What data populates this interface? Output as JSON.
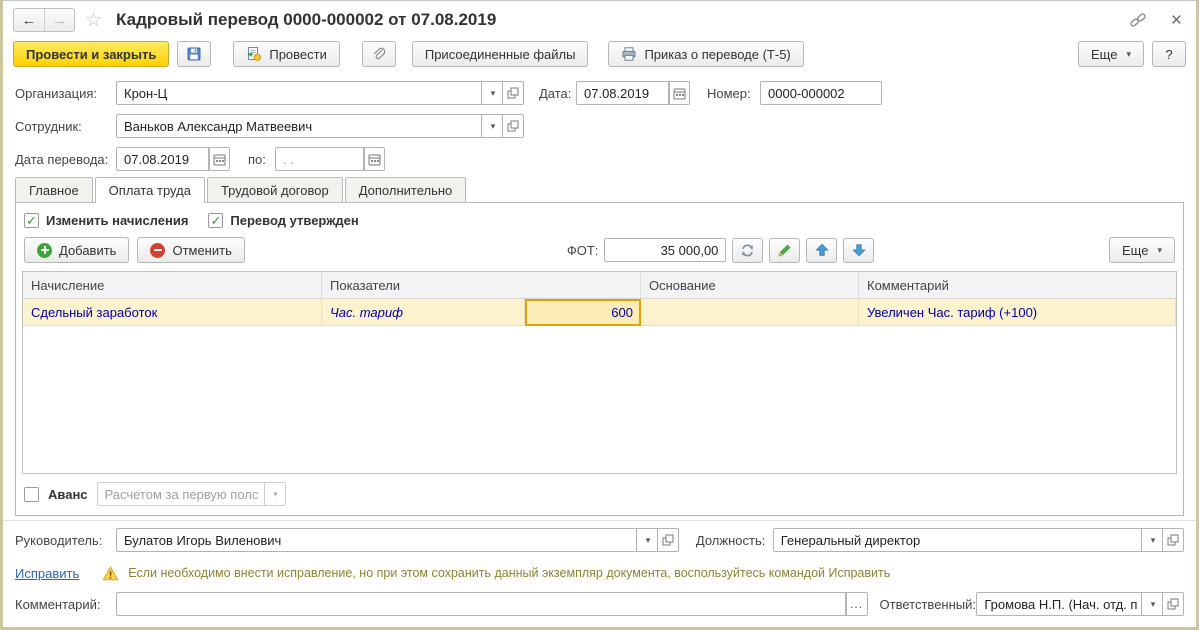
{
  "colors": {
    "accent_yellow": "#fad201",
    "selected_cell_border": "#dfa207",
    "table_row_highlight": "#fcf2cd",
    "table_text_blue": "#0000a6",
    "link_blue": "#2a66b8",
    "hint_olive": "#8a8433",
    "window_frame": "#cdc79d"
  },
  "icons": {
    "back": "←",
    "forward": "→",
    "star": "☆",
    "close": "×",
    "dropdown": "▾",
    "check": "✓",
    "ellipsis": "...",
    "help": "?"
  },
  "titlebar": {
    "title": "Кадровый перевод 0000-000002 от 07.08.2019"
  },
  "toolbar": {
    "post_and_close": "Провести и закрыть",
    "post": "Провести",
    "attached_files": "Присоединенные файлы",
    "print_order": "Приказ о переводе (Т-5)",
    "more": "Еще",
    "help": "?"
  },
  "fields": {
    "org_label": "Организация:",
    "org_value": "Крон-Ц",
    "date_label": "Дата:",
    "date_value": "07.08.2019",
    "number_label": "Номер:",
    "number_value": "0000-000002",
    "employee_label": "Сотрудник:",
    "employee_value": "Ваньков Александр Матвеевич",
    "transfer_from_label": "Дата перевода:",
    "transfer_from_value": "07.08.2019",
    "transfer_to_label": "по:",
    "transfer_to_value": ". ."
  },
  "tabs": {
    "active": "Оплата труда",
    "items": [
      {
        "label": "Главное"
      },
      {
        "label": "Оплата труда"
      },
      {
        "label": "Трудовой договор"
      },
      {
        "label": "Дополнительно"
      }
    ]
  },
  "salary_tab": {
    "change_accruals_label": "Изменить начисления",
    "transfer_approved_label": "Перевод утвержден",
    "add_label": "Добавить",
    "cancel_label": "Отменить",
    "fot_label": "ФОТ:",
    "fot_value": "35 000,00",
    "more": "Еще"
  },
  "table": {
    "headers": [
      "Начисление",
      "Показатели",
      "Основание",
      "Комментарий"
    ],
    "rows": [
      {
        "accrual": "Сдельный заработок",
        "indicator": "Час. тариф",
        "value": "600",
        "basis": "",
        "comment": "Увеличен Час. тариф (+100)"
      }
    ]
  },
  "advance": {
    "label": "Аванс",
    "value": "Расчетом за первую полс"
  },
  "footer": {
    "manager_label": "Руководитель:",
    "manager_value": "Булатов Игорь Виленович",
    "position_label": "Должность:",
    "position_value": "Генеральный директор",
    "fix_link": "Исправить",
    "fix_hint": "Если необходимо внести исправление, но при этом сохранить данный экземпляр документа, воспользуйтесь командой Исправить",
    "comment_label": "Комментарий:",
    "comment_value": "",
    "responsible_label": "Ответственный:",
    "responsible_value": "Громова Н.П. (Нач. отд. п"
  }
}
